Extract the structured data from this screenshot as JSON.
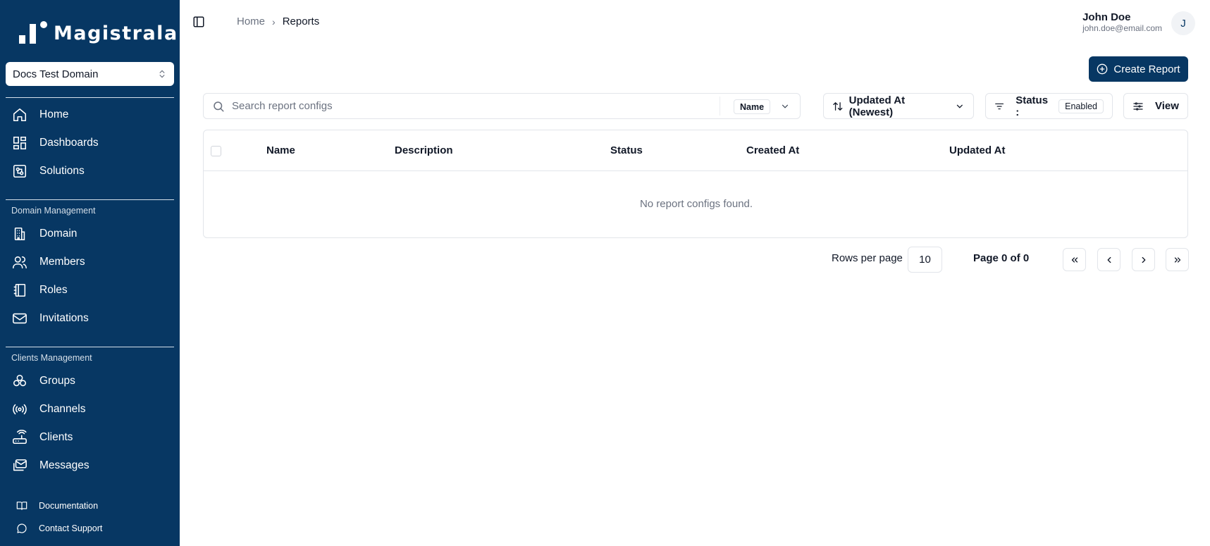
{
  "app": {
    "name": "Magistrala"
  },
  "domain_select": {
    "value": "Docs Test Domain"
  },
  "sidebar": {
    "main_items": [
      {
        "label": "Home",
        "icon": "home-icon"
      },
      {
        "label": "Dashboards",
        "icon": "dashboard-icon"
      },
      {
        "label": "Solutions",
        "icon": "solutions-icon"
      }
    ],
    "domain_section_label": "Domain Management",
    "domain_items": [
      {
        "label": "Domain",
        "icon": "building-icon"
      },
      {
        "label": "Members",
        "icon": "users-icon"
      },
      {
        "label": "Roles",
        "icon": "book-icon"
      },
      {
        "label": "Invitations",
        "icon": "mail-icon"
      }
    ],
    "clients_section_label": "Clients Management",
    "clients_items": [
      {
        "label": "Groups",
        "icon": "groups-icon"
      },
      {
        "label": "Channels",
        "icon": "radio-icon"
      },
      {
        "label": "Clients",
        "icon": "router-icon"
      },
      {
        "label": "Messages",
        "icon": "messages-icon"
      }
    ],
    "footer_items": [
      {
        "label": "Documentation",
        "icon": "book-open-icon"
      },
      {
        "label": "Contact Support",
        "icon": "chat-bubble-icon"
      }
    ]
  },
  "breadcrumb": {
    "home": "Home",
    "current": "Reports"
  },
  "user": {
    "name": "John Doe",
    "email": "john.doe@email.com",
    "initial": "J"
  },
  "toolbar": {
    "create_label": "Create Report",
    "search_placeholder": "Search report configs",
    "search_field": "Name",
    "sort_label": "Updated At (Newest)",
    "filter_label": "Status :",
    "filter_value": "Enabled",
    "view_label": "View"
  },
  "table": {
    "columns": [
      "Name",
      "Description",
      "Status",
      "Created At",
      "Updated At"
    ],
    "empty_message": "No report configs found."
  },
  "pagination": {
    "rows_label": "Rows per page",
    "rows_value": "10",
    "page_info": "Page 0 of 0"
  },
  "colors": {
    "sidebar_bg": "#073763",
    "primary": "#073763"
  }
}
